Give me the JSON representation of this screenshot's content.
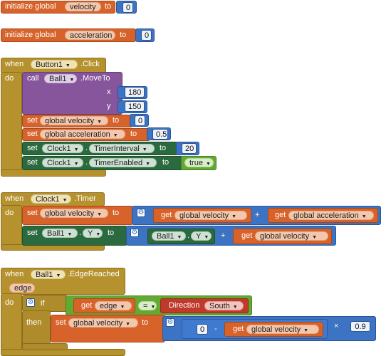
{
  "init1": {
    "label": "initialize global",
    "name": "velocity",
    "to": "to",
    "value": "0"
  },
  "init2": {
    "label": "initialize global",
    "name": "acceleration",
    "to": "to",
    "value": "0"
  },
  "ev1": {
    "when": "when",
    "component": "Button1",
    "event": ".Click",
    "do": "do",
    "call": "call",
    "ball": "Ball1",
    "method": ".MoveTo",
    "x_label": "x",
    "x_value": "180",
    "y_label": "y",
    "y_value": "150",
    "set1": {
      "set": "set",
      "var": "global velocity",
      "to": "to",
      "value": "0"
    },
    "set2": {
      "set": "set",
      "var": "global acceleration",
      "to": "to",
      "value": "0.5"
    },
    "set3": {
      "set": "set",
      "comp": "Clock1",
      "prop": "TimerInterval",
      "to": "to",
      "value": "20"
    },
    "set4": {
      "set": "set",
      "comp": "Clock1",
      "prop": "TimerEnabled",
      "to": "to",
      "value": "true"
    }
  },
  "ev2": {
    "when": "when",
    "component": "Clock1",
    "event": ".Timer",
    "do": "do",
    "set1": {
      "set": "set",
      "var": "global velocity",
      "to": "to",
      "get1": "get",
      "get1_var": "global velocity",
      "op": "+",
      "get2": "get",
      "get2_var": "global acceleration"
    },
    "set2": {
      "set": "set",
      "comp": "Ball1",
      "prop": "Y",
      "to": "to",
      "comp2": "Ball1",
      "prop2": "Y",
      "op": "+",
      "get": "get",
      "get_var": "global velocity"
    }
  },
  "ev3": {
    "when": "when",
    "component": "Ball1",
    "event": ".EdgeReached",
    "param": "edge",
    "do": "do",
    "if": "if",
    "then": "then",
    "get": "get",
    "get_var": "edge",
    "eq": "=",
    "dir_label": "Direction",
    "dir_value": "South",
    "set": "set",
    "var": "global velocity",
    "to": "to",
    "zero": "0",
    "minus": "-",
    "get2": "get",
    "get2_var": "global velocity",
    "times": "×",
    "factor": "0.9"
  },
  "colors": {
    "variable": "#d7632b",
    "event": "#b5922e",
    "component_call": "#86559b",
    "component_set": "#2b6a3f",
    "math": "#3c73c2",
    "logic": "#63a932",
    "helper": "#c0392b"
  }
}
